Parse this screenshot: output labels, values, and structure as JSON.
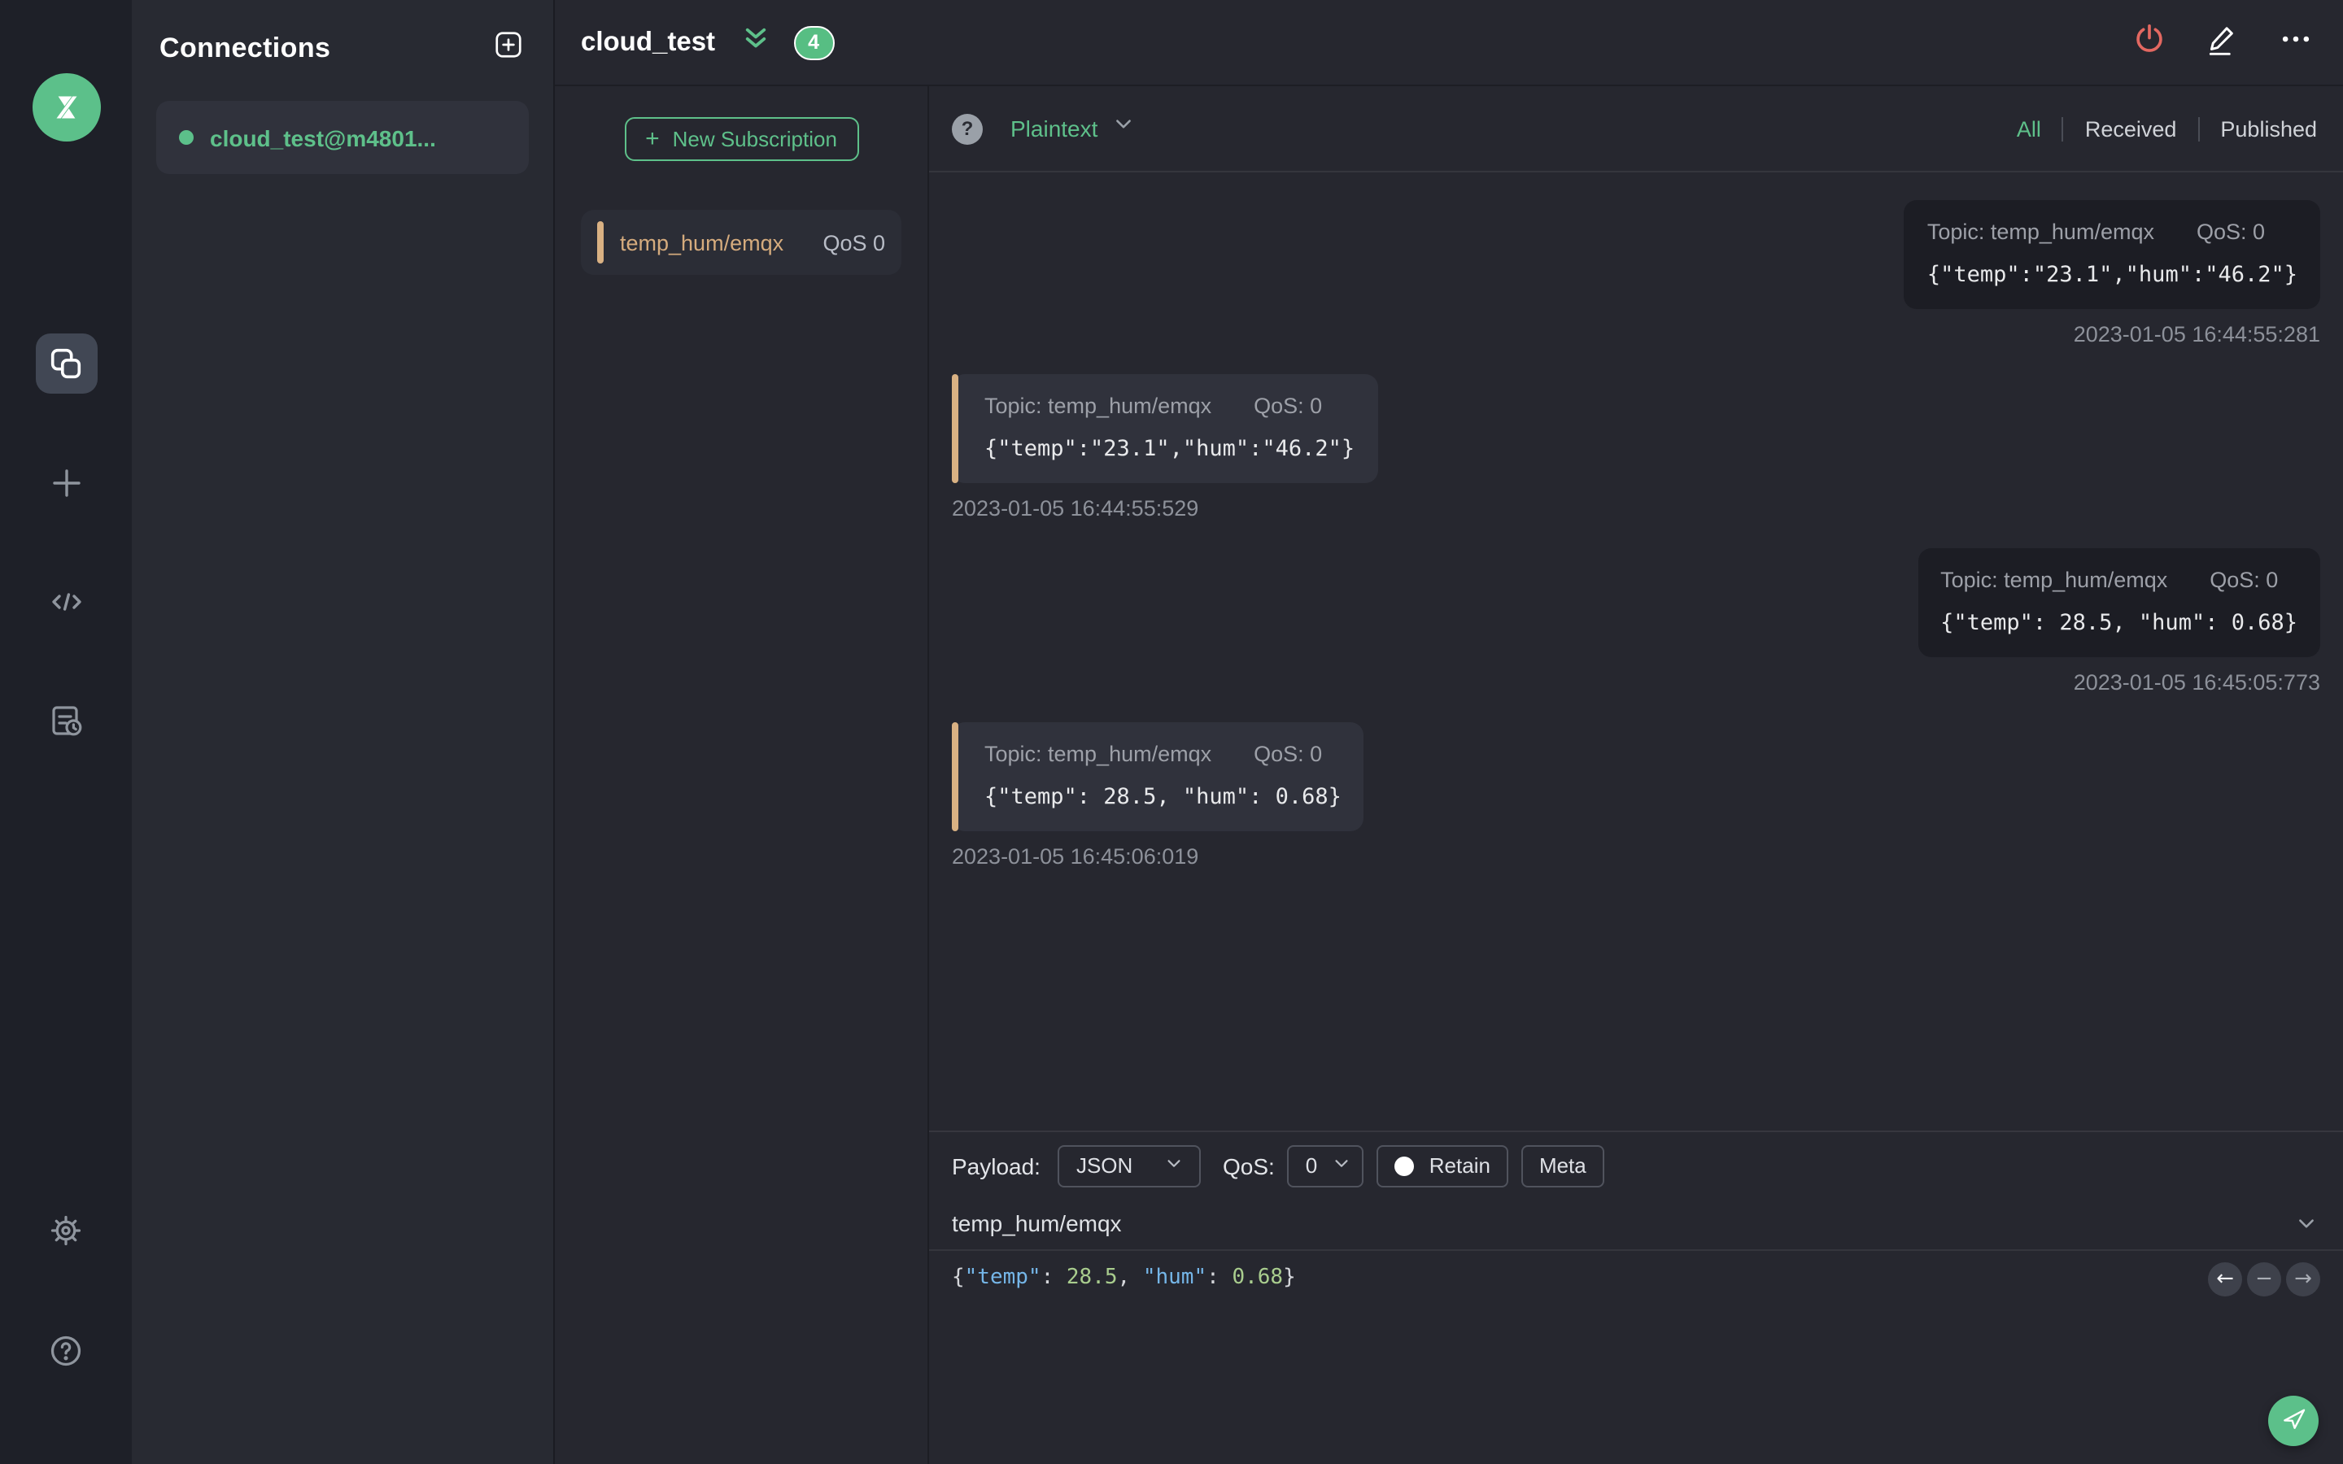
{
  "colors": {
    "accent_green": "#5cc08a",
    "badge_green": "#57be83",
    "danger_red": "#e36861",
    "topic_tan": "#d9b183",
    "syntax_key_blue": "#75b6e8",
    "syntax_number_green": "#a9cd8e"
  },
  "sidebar": {
    "logo": "mqttx-logo",
    "nav_icons": [
      "connections",
      "new-connection",
      "script",
      "log"
    ],
    "bottom_icons": [
      "settings",
      "help"
    ]
  },
  "connections": {
    "title": "Connections",
    "items": [
      {
        "name": "cloud_test@m4801...",
        "status": "connected"
      }
    ]
  },
  "topbar": {
    "title": "cloud_test",
    "badge_count": "4"
  },
  "subscriptions": {
    "new_button_label": "New Subscription",
    "new_button_plus": "+",
    "items": [
      {
        "topic": "temp_hum/emqx",
        "qos": "QoS 0"
      }
    ]
  },
  "messages": {
    "format_selected": "Plaintext",
    "help_glyph": "?",
    "filters": {
      "all": "All",
      "received": "Received",
      "published": "Published"
    },
    "active_filter": "All",
    "items": [
      {
        "direction": "published",
        "meta_topic": "Topic: temp_hum/emqx",
        "meta_qos": "QoS: 0",
        "payload": "{\"temp\":\"23.1\",\"hum\":\"46.2\"}",
        "timestamp": "2023-01-05 16:44:55:281"
      },
      {
        "direction": "received",
        "meta_topic": "Topic: temp_hum/emqx",
        "meta_qos": "QoS: 0",
        "payload": "{\"temp\":\"23.1\",\"hum\":\"46.2\"}",
        "timestamp": "2023-01-05 16:44:55:529"
      },
      {
        "direction": "published",
        "meta_topic": "Topic: temp_hum/emqx",
        "meta_qos": "QoS: 0",
        "payload": "{\"temp\": 28.5, \"hum\": 0.68}",
        "timestamp": "2023-01-05 16:45:05:773"
      },
      {
        "direction": "received",
        "meta_topic": "Topic: temp_hum/emqx",
        "meta_qos": "QoS: 0",
        "payload": "{\"temp\": 28.5, \"hum\": 0.68}",
        "timestamp": "2023-01-05 16:45:06:019"
      }
    ]
  },
  "publish": {
    "payload_label": "Payload:",
    "format_value": "JSON",
    "qos_label": "QoS:",
    "qos_value": "0",
    "retain_label": "Retain",
    "meta_label": "Meta",
    "topic_value": "temp_hum/emqx",
    "history_prev": "←",
    "history_delete": "−",
    "history_next": "→",
    "payload_tokens": [
      {
        "text": "{",
        "type": "punct"
      },
      {
        "text": "\"temp\"",
        "type": "key"
      },
      {
        "text": ": ",
        "type": "punct"
      },
      {
        "text": "28.5",
        "type": "number"
      },
      {
        "text": ", ",
        "type": "punct"
      },
      {
        "text": "\"hum\"",
        "type": "key"
      },
      {
        "text": ": ",
        "type": "punct"
      },
      {
        "text": "0.68",
        "type": "number"
      },
      {
        "text": "}",
        "type": "punct"
      }
    ]
  }
}
